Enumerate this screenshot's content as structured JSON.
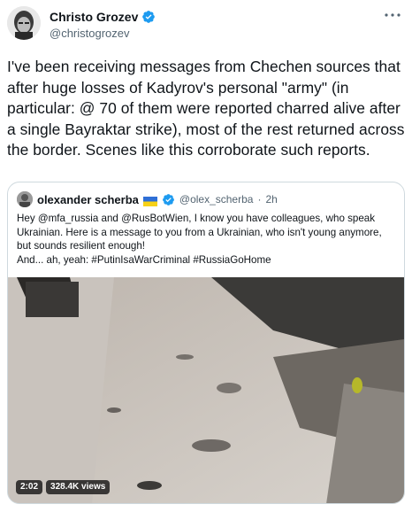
{
  "author": {
    "name": "Christo Grozev",
    "handle": "@christogrozev",
    "verified_icon": "verified-badge-icon",
    "more_icon": "more-dots-icon"
  },
  "tweet_text": "I've been receiving messages from Chechen sources that after huge losses of Kadyrov's personal \"army\" (in particular: @ 70 of them were reported charred alive after a single Bayraktar strike), most of the rest returned across the border. Scenes like this corroborate such reports.",
  "quoted": {
    "name": "olexander scherba",
    "handle": "@olex_scherba",
    "separator": "·",
    "time": "2h",
    "text": "Hey @mfa_russia and @RusBotWien, I know you have colleagues, who speak Ukrainian. Here is a message to you from a Ukrainian, who isn't young anymore, but sounds resilient enough!\nAnd... ah, yeah: #PutinIsaWarCriminal #RussiaGoHome",
    "video": {
      "duration": "2:02",
      "views": "328.4K views"
    }
  },
  "colors": {
    "text": "#0f1419",
    "secondary": "#536471",
    "verified": "#1d9bf0",
    "border": "#cfd9de"
  }
}
